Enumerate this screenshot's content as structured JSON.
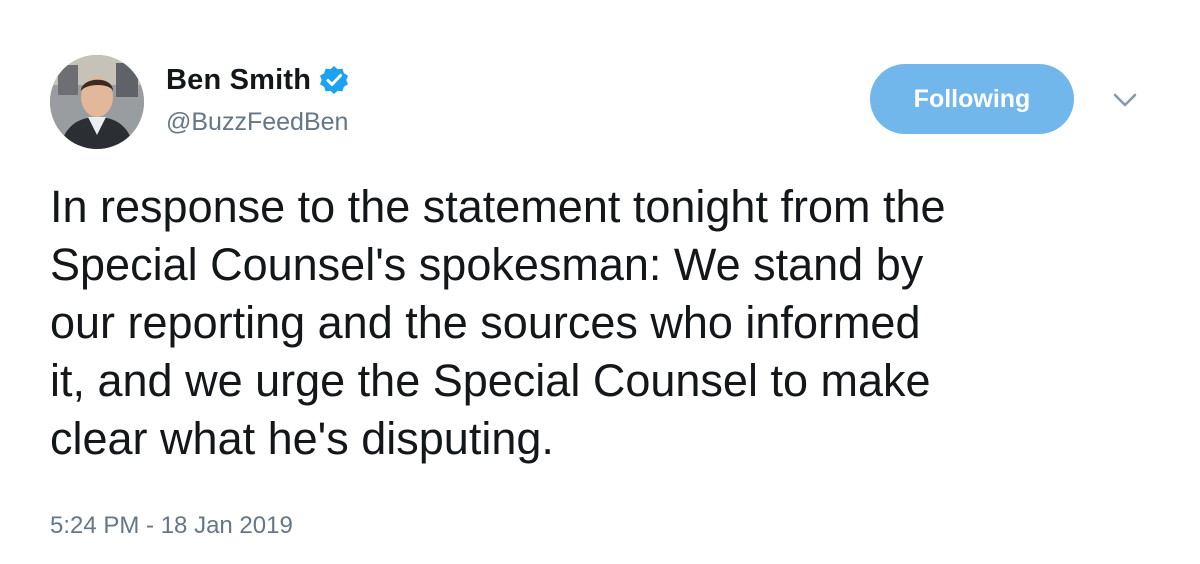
{
  "author": {
    "display_name": "Ben Smith",
    "handle": "@BuzzFeedBen",
    "verified": true
  },
  "follow_button": {
    "label": "Following"
  },
  "menu": {
    "icon": "chevron-down-icon"
  },
  "tweet": {
    "text": "In response to the statement tonight from the\nSpecial Counsel's spokesman: We stand by\nour reporting and the sources who informed\nit, and we urge the Special Counsel to make\nclear what he's disputing.",
    "timestamp": "5:24 PM - 18 Jan 2019"
  },
  "colors": {
    "accent": "#1da1f2",
    "button_bg": "#71b7ec",
    "secondary_text": "#657786",
    "primary_text": "#14171a"
  }
}
